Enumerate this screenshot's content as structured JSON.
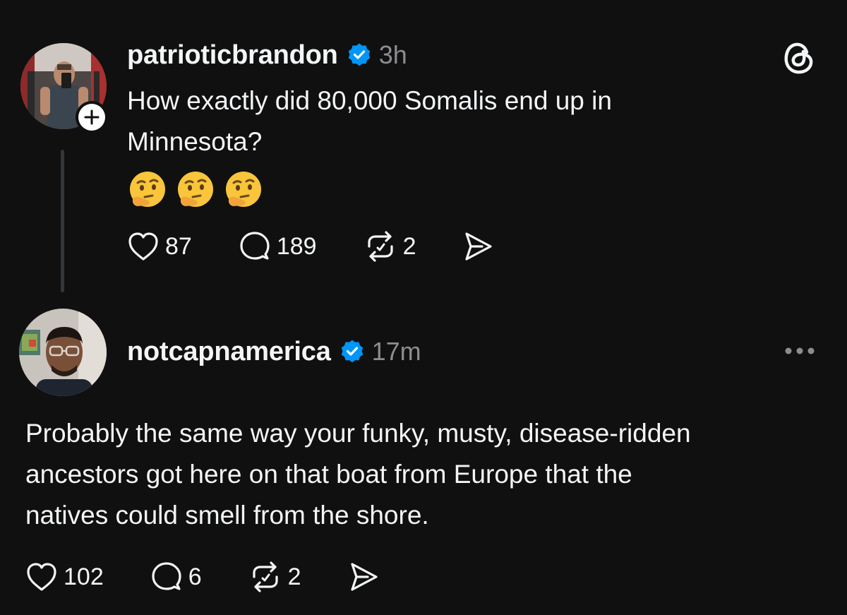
{
  "colors": {
    "background": "#101010",
    "text_primary": "#f3f5f7",
    "text_secondary": "#8b8d90",
    "verified_blue": "#0095f6",
    "thread_line": "#333638"
  },
  "app": {
    "logo_icon": "threads-logo-icon"
  },
  "post": {
    "username": "patrioticbrandon",
    "verified": true,
    "timestamp": "3h",
    "text": "How exactly did 80,000 Somalis end up in\nMinnesota?",
    "emoji": [
      "🤔",
      "🤔",
      "🤔"
    ],
    "follow_icon": "plus-icon",
    "actions": {
      "likes": "87",
      "replies": "189",
      "reposts": "2"
    }
  },
  "reply": {
    "username": "notcapnamerica",
    "verified": true,
    "timestamp": "17m",
    "text": "Probably the same way your funky, musty, disease-ridden\nancestors got here on that boat from Europe that the\nnatives could smell from the shore.",
    "more_icon": "more-dots-icon",
    "actions": {
      "likes": "102",
      "replies": "6",
      "reposts": "2"
    }
  }
}
